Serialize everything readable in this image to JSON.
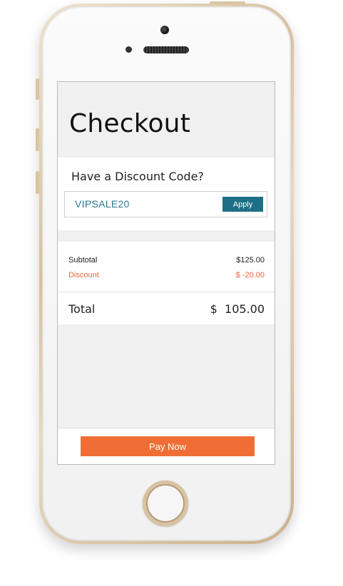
{
  "app": {
    "title": "Checkout"
  },
  "discount": {
    "heading": "Have a Discount Code?",
    "code_value": "VIPSALE20",
    "apply_label": "Apply"
  },
  "summary": {
    "subtotal_label": "Subtotal",
    "subtotal_value": "$125.00",
    "discount_label": "Discount",
    "discount_value": "$ -20.00",
    "total_label": "Total",
    "total_value": "$  105.00"
  },
  "footer": {
    "pay_label": "Pay Now"
  },
  "colors": {
    "accent_teal": "#1e6f86",
    "code_text": "#2b7a93",
    "pay_orange": "#f06e35",
    "discount_orange": "#e8673a"
  },
  "icons": {
    "camera": "front-camera-icon",
    "speaker": "earpiece-speaker-icon",
    "home": "home-button-icon"
  }
}
